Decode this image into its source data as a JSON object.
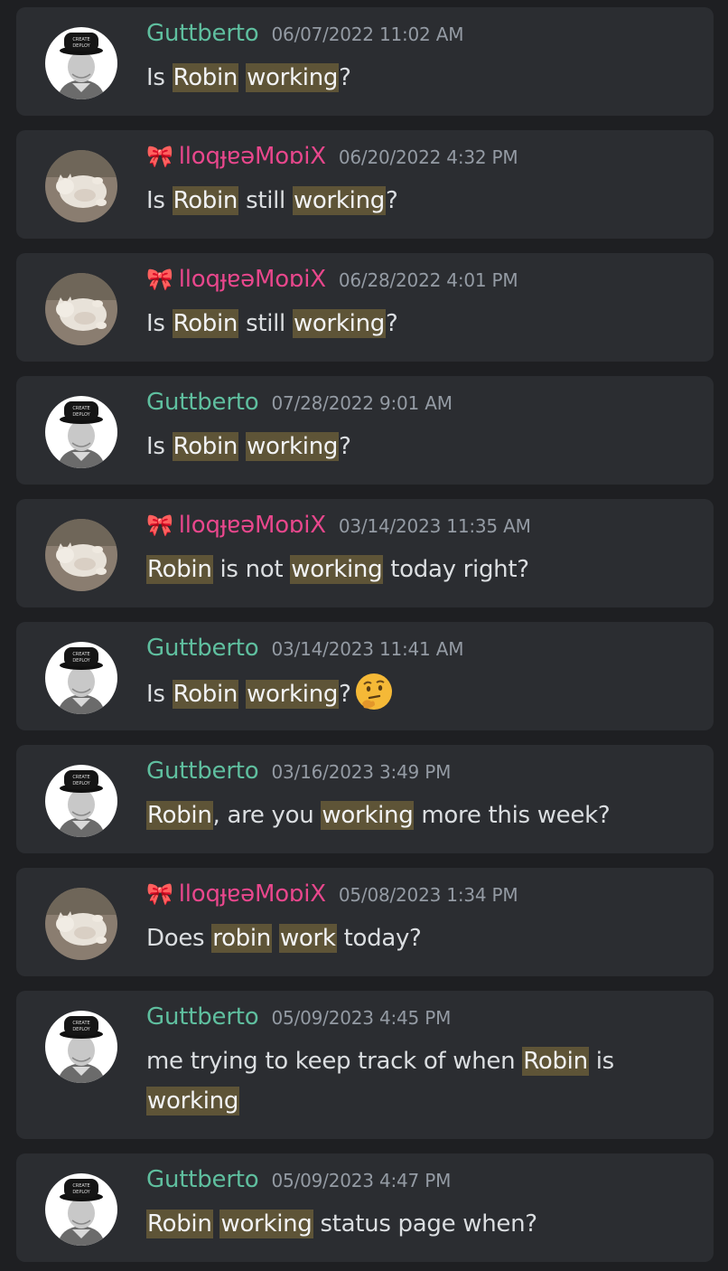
{
  "colors": {
    "guttberto_name": "#5fbf9f",
    "pinkuser_name": "#e8478c",
    "timestamp": "#949ba4",
    "highlight_bg": "#5e5437"
  },
  "messages": [
    {
      "author": "Guttberto",
      "author_type": "guttberto",
      "timestamp": "06/07/2022 11:02 AM",
      "segments": [
        {
          "t": "Is "
        },
        {
          "t": "Robin",
          "hl": true
        },
        {
          "t": " "
        },
        {
          "t": "working",
          "hl": true
        },
        {
          "t": "?"
        }
      ]
    },
    {
      "author": "lloqɟɐəMoɒiX",
      "author_type": "pink",
      "timestamp": "06/20/2022 4:32 PM",
      "segments": [
        {
          "t": "Is "
        },
        {
          "t": "Robin",
          "hl": true
        },
        {
          "t": " still "
        },
        {
          "t": "working",
          "hl": true
        },
        {
          "t": "?"
        }
      ]
    },
    {
      "author": "lloqɟɐəMoɒiX",
      "author_type": "pink",
      "timestamp": "06/28/2022 4:01 PM",
      "segments": [
        {
          "t": "Is "
        },
        {
          "t": "Robin",
          "hl": true
        },
        {
          "t": " still "
        },
        {
          "t": "working",
          "hl": true
        },
        {
          "t": "?"
        }
      ]
    },
    {
      "author": "Guttberto",
      "author_type": "guttberto",
      "timestamp": "07/28/2022 9:01 AM",
      "segments": [
        {
          "t": "Is "
        },
        {
          "t": "Robin",
          "hl": true
        },
        {
          "t": " "
        },
        {
          "t": "working",
          "hl": true
        },
        {
          "t": "?"
        }
      ]
    },
    {
      "author": "lloqɟɐəMoɒiX",
      "author_type": "pink",
      "timestamp": "03/14/2023 11:35 AM",
      "segments": [
        {
          "t": "Robin",
          "hl": true
        },
        {
          "t": " is not "
        },
        {
          "t": "working",
          "hl": true
        },
        {
          "t": " today right?"
        }
      ]
    },
    {
      "author": "Guttberto",
      "author_type": "guttberto",
      "timestamp": "03/14/2023 11:41 AM",
      "emoji": "thinking-face",
      "segments": [
        {
          "t": "Is "
        },
        {
          "t": "Robin",
          "hl": true
        },
        {
          "t": " "
        },
        {
          "t": "working",
          "hl": true
        },
        {
          "t": "?"
        }
      ]
    },
    {
      "author": "Guttberto",
      "author_type": "guttberto",
      "timestamp": "03/16/2023 3:49 PM",
      "segments": [
        {
          "t": "Robin",
          "hl": true
        },
        {
          "t": ", are you "
        },
        {
          "t": "working",
          "hl": true
        },
        {
          "t": " more this week?"
        }
      ]
    },
    {
      "author": "lloqɟɐəMoɒiX",
      "author_type": "pink",
      "timestamp": "05/08/2023 1:34 PM",
      "segments": [
        {
          "t": "Does "
        },
        {
          "t": "robin",
          "hl": true
        },
        {
          "t": " "
        },
        {
          "t": "work",
          "hl": true
        },
        {
          "t": " today?"
        }
      ]
    },
    {
      "author": "Guttberto",
      "author_type": "guttberto",
      "timestamp": "05/09/2023 4:45 PM",
      "segments": [
        {
          "t": "me trying to keep track of when "
        },
        {
          "t": "Robin",
          "hl": true
        },
        {
          "t": " is "
        },
        {
          "t": "working",
          "hl": true
        }
      ]
    },
    {
      "author": "Guttberto",
      "author_type": "guttberto",
      "timestamp": "05/09/2023 4:47 PM",
      "segments": [
        {
          "t": "Robin",
          "hl": true
        },
        {
          "t": " "
        },
        {
          "t": "working",
          "hl": true
        },
        {
          "t": " status page when?"
        }
      ]
    }
  ]
}
